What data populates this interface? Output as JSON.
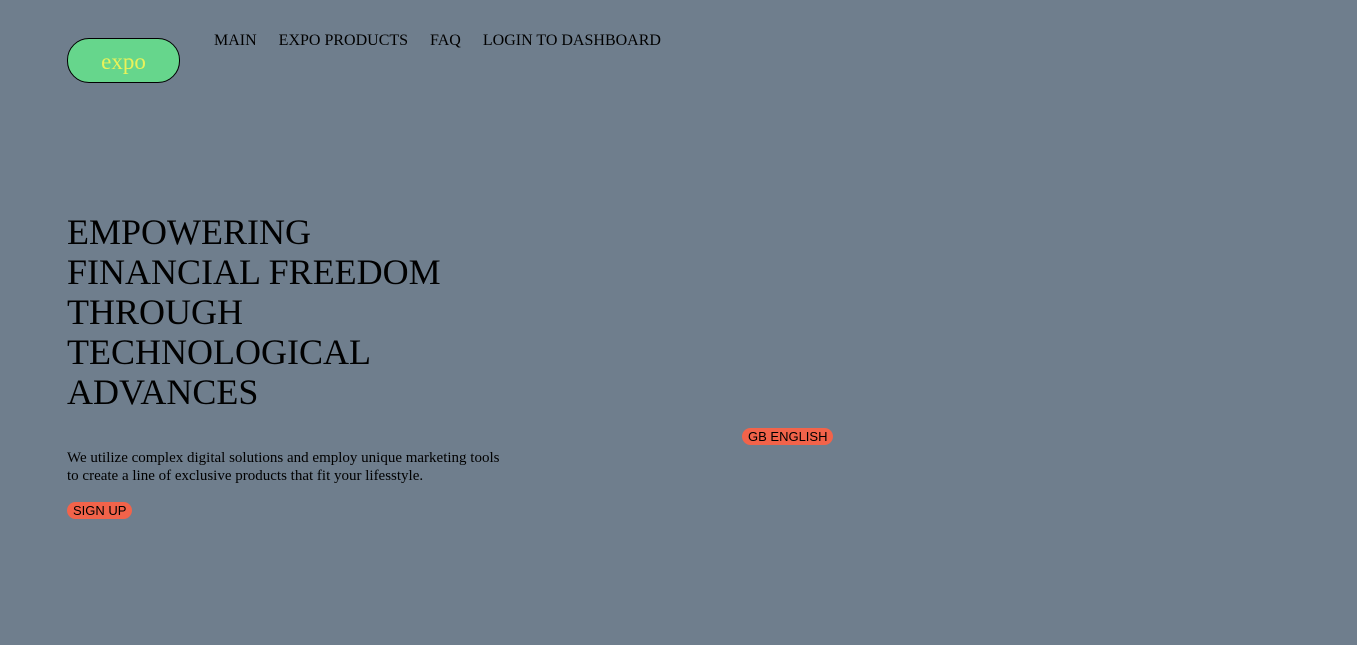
{
  "header": {
    "logo_text": "expo",
    "logo_bg_color": "#66d68c",
    "logo_text_color": "#e9f25a",
    "nav": [
      {
        "label": "MAIN"
      },
      {
        "label": "EXPO PRODUCTS"
      },
      {
        "label": "FAQ"
      },
      {
        "label": "LOGIN TO DASHBOARD"
      }
    ]
  },
  "hero": {
    "title_lines": [
      "EMPOWERING",
      "FINANCIAL FREEDOM",
      "THROUGH",
      "TECHNOLOGICAL",
      "ADVANCES"
    ],
    "description": "We utilize complex digital solutions and employ unique marketing tools to create a line of exclusive products that fit your lifesstyle.",
    "signup_label": "SIGN UP"
  },
  "language": {
    "label": "GB ENGLISH"
  },
  "colors": {
    "background": "#6f7e8d",
    "accent": "#f2634a"
  }
}
